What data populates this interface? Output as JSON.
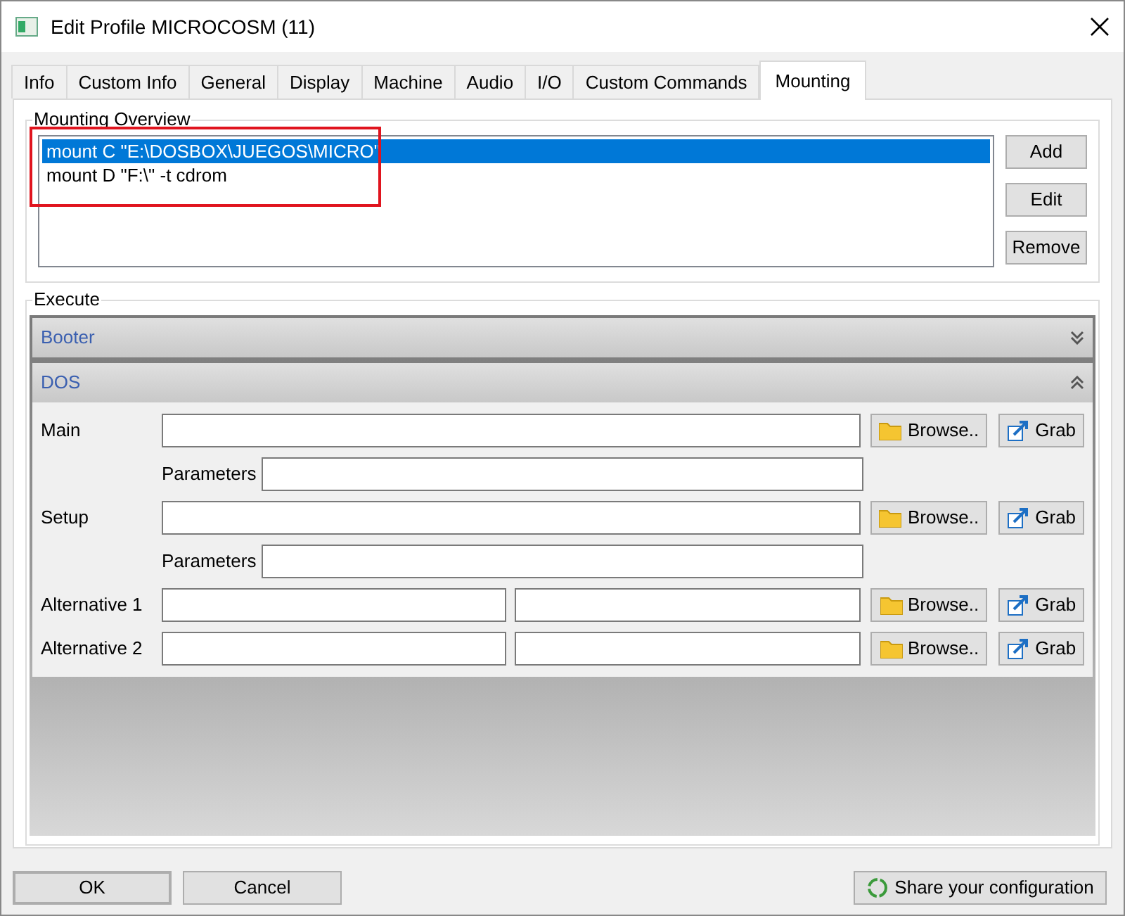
{
  "window": {
    "title": "Edit Profile MICROCOSM (11)"
  },
  "tabs": [
    {
      "label": "Info",
      "selected": false
    },
    {
      "label": "Custom Info",
      "selected": false
    },
    {
      "label": "General",
      "selected": false
    },
    {
      "label": "Display",
      "selected": false
    },
    {
      "label": "Machine",
      "selected": false
    },
    {
      "label": "Audio",
      "selected": false
    },
    {
      "label": "I/O",
      "selected": false
    },
    {
      "label": "Custom Commands",
      "selected": false
    },
    {
      "label": "Mounting",
      "selected": true
    }
  ],
  "mounting_overview": {
    "title": "Mounting Overview",
    "items": [
      {
        "label": "mount C \"E:\\DOSBOX\\JUEGOS\\MICRO\"",
        "selected": true
      },
      {
        "label": "mount D \"F:\\\" -t cdrom",
        "selected": false
      }
    ],
    "buttons": [
      "Add",
      "Edit",
      "Remove"
    ]
  },
  "execute": {
    "title": "Execute",
    "sections": [
      {
        "title": "Booter",
        "expanded": false
      },
      {
        "title": "DOS",
        "expanded": true,
        "rows": [
          {
            "kind": "single",
            "label": "Main",
            "browse": "Browse..",
            "grab": "Grab"
          },
          {
            "kind": "parameters",
            "label": "Parameters"
          },
          {
            "kind": "single",
            "label": "Setup",
            "browse": "Browse..",
            "grab": "Grab"
          },
          {
            "kind": "parameters",
            "label": "Parameters"
          },
          {
            "kind": "double",
            "label": "Alternative 1",
            "browse": "Browse..",
            "grab": "Grab"
          },
          {
            "kind": "double",
            "label": "Alternative 2",
            "browse": "Browse..",
            "grab": "Grab"
          }
        ]
      }
    ]
  },
  "footer": {
    "ok": "OK",
    "cancel": "Cancel",
    "share": "Share your configuration"
  }
}
